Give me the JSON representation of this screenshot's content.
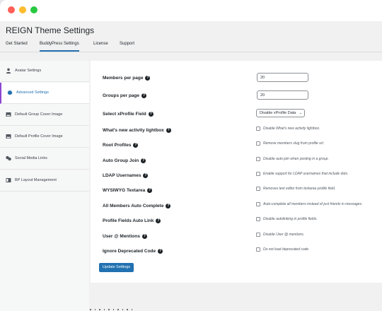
{
  "window": {
    "controls": [
      "close",
      "minimize",
      "maximize"
    ]
  },
  "page": {
    "title": "REIGN Theme Settings"
  },
  "tabs": [
    {
      "label": "Get Started",
      "active": false
    },
    {
      "label": "BuddyPress Settings",
      "active": true
    },
    {
      "label": "License",
      "active": false
    },
    {
      "label": "Support",
      "active": false
    }
  ],
  "sidebar": {
    "items": [
      {
        "label": "Avatar Settings",
        "icon": "user-icon",
        "active": false
      },
      {
        "label": "Advanced Settings",
        "icon": "gear-icon",
        "active": true
      },
      {
        "label": "Default Group Cover Image",
        "icon": "image-icon",
        "active": false
      },
      {
        "label": "Default Profile Cover Image",
        "icon": "image-icon",
        "active": false
      },
      {
        "label": "Social Media Links",
        "icon": "share-icon",
        "active": false
      },
      {
        "label": "BP Layout Management",
        "icon": "layout-icon",
        "active": false
      }
    ]
  },
  "settings": {
    "members_per_page": {
      "label": "Members per page",
      "value": "20"
    },
    "groups_per_page": {
      "label": "Groups per page",
      "value": "20"
    },
    "xprofile_field": {
      "label": "Select xProfile Field",
      "selected": "Disable xProfile Data"
    },
    "toggles": [
      {
        "label": "What's new activity lightbox",
        "description": "Disable What's new activity lightbox.",
        "checked": false
      },
      {
        "label": "Root Profiles",
        "description": "Remove members slug from profile url.",
        "checked": false
      },
      {
        "label": "Auto Group Join",
        "description": "Disable auto join when posting in a group.",
        "checked": false
      },
      {
        "label": "LDAP Usernames",
        "description": "Enable support for LDAP usernames that include dots.",
        "checked": false
      },
      {
        "label": "WYSIWYG Textarea",
        "description": "Removes text editor from textarea profile field.",
        "checked": false
      },
      {
        "label": "All Members Auto Complete",
        "description": "Auto-complete all members instead of just friends in messages.",
        "checked": false
      },
      {
        "label": "Profile Fields Auto Link",
        "description": "Disable autolinking in profile fields.",
        "checked": false
      },
      {
        "label": "User @ Mentions",
        "description": "Disable User @ mentions.",
        "checked": false
      },
      {
        "label": "Ignore Deprecated Code",
        "description": "Do not load deprecated code",
        "checked": false
      }
    ],
    "help_glyph": "?"
  },
  "actions": {
    "update_label": "Update Settings"
  },
  "colors": {
    "accent": "#2271b1",
    "active_border": "#8c47d1"
  }
}
